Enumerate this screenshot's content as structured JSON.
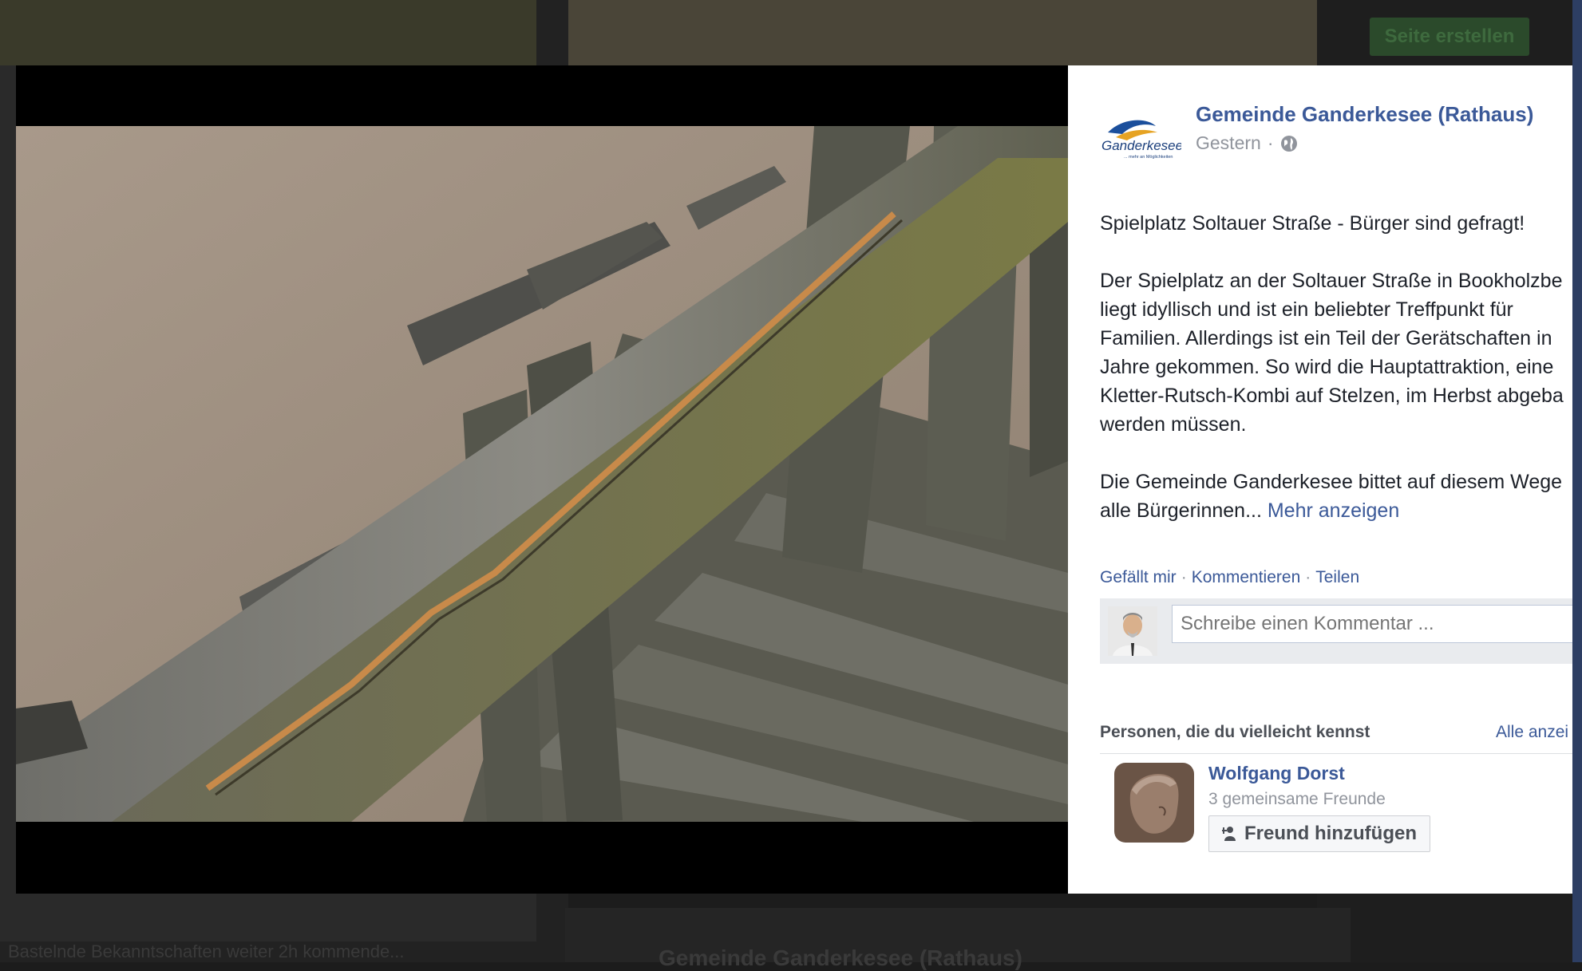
{
  "background": {
    "create_page_button": "Seite erstellen",
    "card_title": "Gemeinde Ganderkesee (Rathaus)",
    "bottom_left_text": "Bastelnde Bekanntschaften weiter   2h kommende..."
  },
  "post": {
    "page_name": "Gemeinde Ganderkesee (Rathaus)",
    "timestamp": "Gestern",
    "meta_separator": "·",
    "privacy_icon": "globe-icon",
    "logo_text": "Ganderkesee",
    "logo_tagline": "... mehr an Möglichkeiten",
    "paragraphs": [
      "Spielplatz Soltauer Straße - Bürger sind gefragt!",
      "Der Spielplatz an der Soltauer Straße in Bookholzbe\nliegt idyllisch und ist ein beliebter Treffpunkt für\nFamilien. Allerdings ist ein Teil der Gerätschaften in\nJahre gekommen. So wird die Hauptattraktion, eine\nKletter-Rutsch-Kombi auf Stelzen, im Herbst abgeba\nwerden müssen.",
      "Die Gemeinde Ganderkesee bittet auf diesem Wege\nalle Bürgerinnen..."
    ],
    "more_link": "Mehr anzeigen"
  },
  "actions": {
    "like": "Gefällt mir",
    "comment": "Kommentieren",
    "share": "Teilen",
    "separator": "·"
  },
  "comment": {
    "placeholder": "Schreibe einen Kommentar ..."
  },
  "pymk": {
    "title": "Personen, die du vielleicht kennst",
    "see_all": "Alle anzei",
    "person": {
      "name": "Wolfgang Dorst",
      "mutual": "3 gemeinsame Freunde",
      "add_button": "Freund hinzufügen"
    }
  },
  "colors": {
    "link_blue": "#3b5998",
    "gray_text": "#90949c",
    "body_text": "#1d2129"
  }
}
